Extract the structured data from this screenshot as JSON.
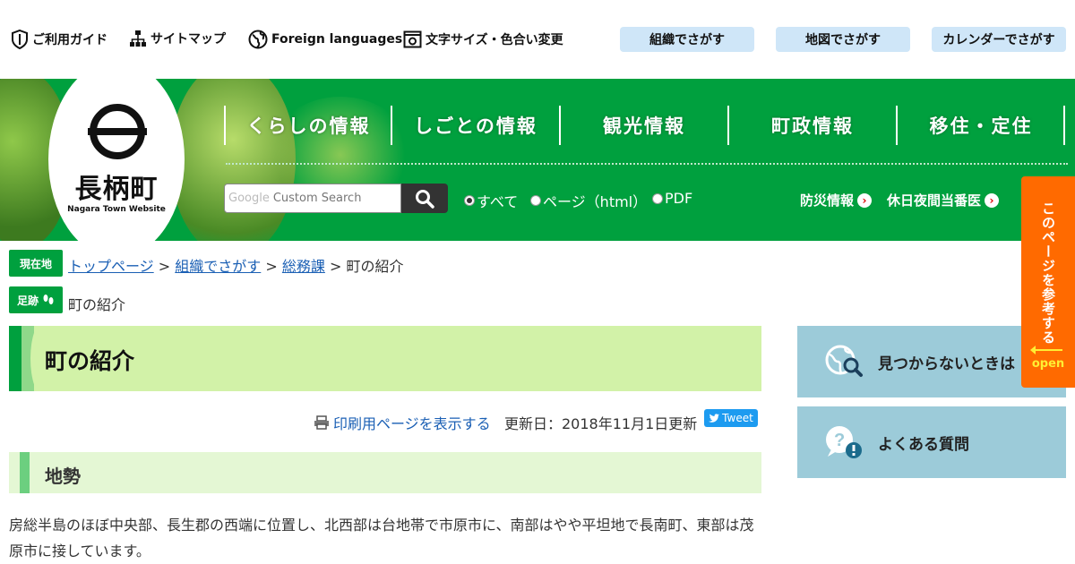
{
  "top_links": {
    "guide": "ご利用ガイド",
    "sitemap": "サイトマップ",
    "foreign": "Foreign languages",
    "textsize": "文字サイズ・色合い変更"
  },
  "top_buttons": {
    "org": "組織でさがす",
    "map": "地図でさがす",
    "calendar": "カレンダーでさがす"
  },
  "logo": {
    "name": "長柄町",
    "sub": "Nagara Town Website"
  },
  "nav": [
    "くらしの情報",
    "しごとの情報",
    "観光情報",
    "町政情報",
    "移住・定住"
  ],
  "search": {
    "google": "Google",
    "placeholder": "Custom Search",
    "radios": [
      "すべて",
      "ページ（html）",
      "PDF"
    ],
    "selected": "すべて"
  },
  "header_links": {
    "disaster": "防災情報",
    "holiday": "休日夜間当番医"
  },
  "breadcrumb": {
    "current_tag": "現在地",
    "items": [
      "トップページ",
      "組織でさがす",
      "総務課"
    ],
    "current": "町の紹介",
    "sep": ">"
  },
  "footprint": {
    "tag": "足跡",
    "items": [
      "町の紹介"
    ]
  },
  "page": {
    "title": "町の紹介",
    "print_label": "印刷用ページを表示する",
    "updated": "更新日：2018年11月1日更新",
    "tweet": "Tweet",
    "section_title": "地勢",
    "body": "房総半島のほぼ中央部、長生郡の西端に位置し、北西部は台地帯で市原市に、南部はやや平坦地で長南町、東部は茂原市に接しています。"
  },
  "sidebar": {
    "notfound": "見つからないときは",
    "faq": "よくある質問"
  },
  "side_tab": {
    "label": "このページを参考する",
    "open": "open"
  },
  "colors": {
    "brand_green": "#00a03e",
    "title_bg": "#d2f2a8",
    "tab_orange": "#ff6a00",
    "side_blue": "#9ccbd9"
  }
}
